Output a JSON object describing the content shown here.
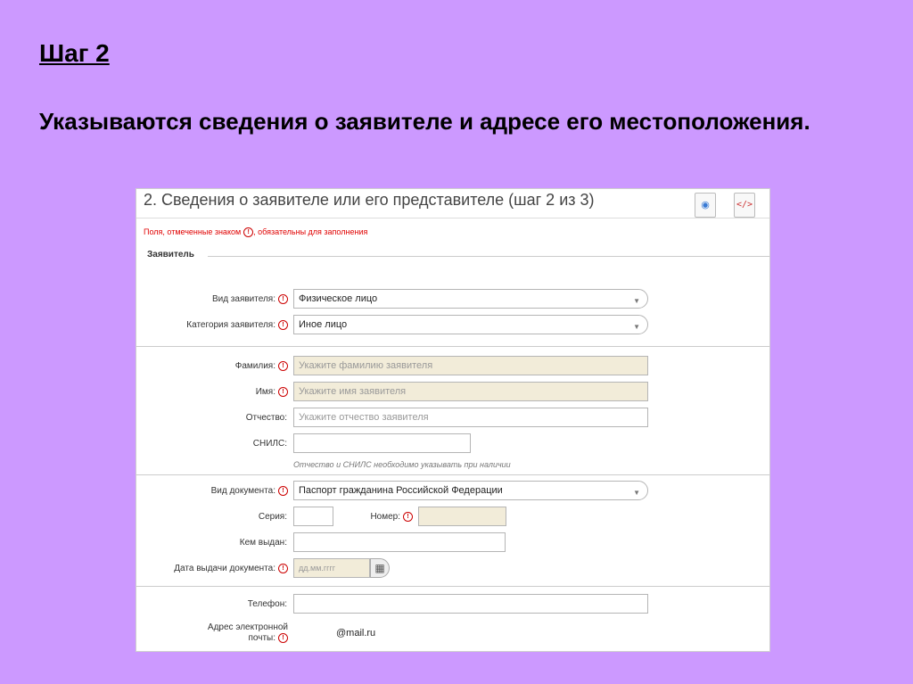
{
  "slide": {
    "heading": "Шаг 2",
    "text": "Указываются сведения о заявителе и адресе его местоположения."
  },
  "form": {
    "title": "2. Сведения о заявителе или его представителе (шаг 2 из 3)",
    "required_note": "Поля, отмеченные знаком",
    "required_note_tail": ", обязательны для заполнения",
    "required_symbol": "!",
    "section_label": "Заявитель",
    "icons": {
      "view": "eye-icon",
      "code": "code-icon"
    },
    "applicant_type": {
      "label": "Вид заявителя:",
      "value": "Физическое лицо"
    },
    "applicant_category": {
      "label": "Категория заявителя:",
      "value": "Иное лицо"
    },
    "surname": {
      "label": "Фамилия:",
      "placeholder": "Укажите фамилию заявителя"
    },
    "name": {
      "label": "Имя:",
      "placeholder": "Укажите имя заявителя"
    },
    "patronymic": {
      "label": "Отчество:",
      "placeholder": "Укажите отчество заявителя"
    },
    "snils": {
      "label": "СНИЛС:",
      "value": ""
    },
    "hint": "Отчество и СНИЛС необходимо указывать при наличии",
    "doc_type": {
      "label": "Вид документа:",
      "value": "Паспорт гражданина Российской Федерации"
    },
    "series": {
      "label": "Серия:",
      "value": ""
    },
    "number": {
      "label": "Номер:",
      "value": ""
    },
    "issued_by": {
      "label": "Кем выдан:",
      "value": ""
    },
    "issue_date": {
      "label": "Дата выдачи документа:",
      "placeholder": "дд.мм.гггг"
    },
    "phone": {
      "label": "Телефон:",
      "value": ""
    },
    "email": {
      "label_line1": "Адрес электронной",
      "label_line2": "почты:",
      "value": "@mail.ru"
    },
    "select_arrow": "▼",
    "calendar_icon": "calendar-icon"
  }
}
